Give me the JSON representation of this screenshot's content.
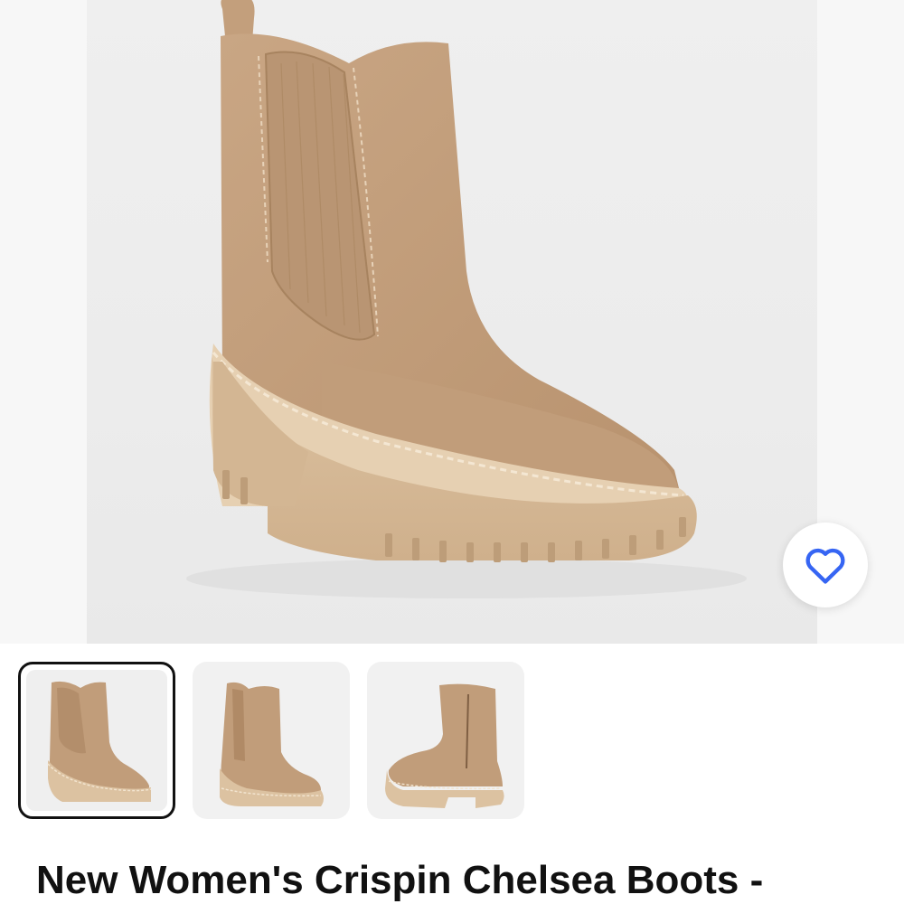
{
  "listing": {
    "title": "New Women's Crispin Chelsea Boots -"
  },
  "hero": {
    "image_subject": "tan suede chelsea boot with lug sole"
  },
  "watch": {
    "icon": "heart-outline-icon",
    "color": "#3665f3"
  },
  "thumbnails": [
    {
      "view": "front three-quarter view",
      "selected": true
    },
    {
      "view": "side view",
      "selected": false
    },
    {
      "view": "inner side view",
      "selected": false
    }
  ],
  "colors": {
    "boot": "#c29f7f",
    "sole": "#d8bd9b",
    "selected_border": "#111111"
  }
}
